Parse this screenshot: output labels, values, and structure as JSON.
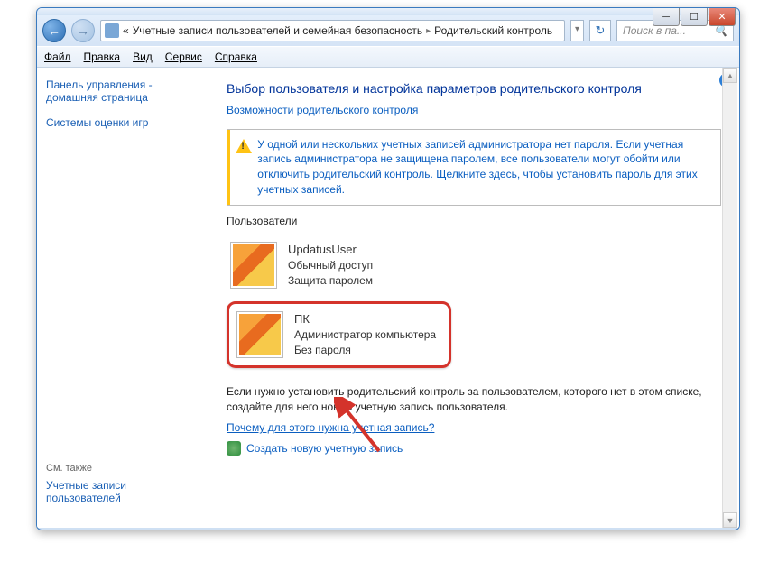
{
  "breadcrumb": {
    "prefix": "«",
    "part1": "Учетные записи пользователей и семейная безопасность",
    "part2": "Родительский контроль"
  },
  "search": {
    "placeholder": "Поиск в па..."
  },
  "menu": {
    "file": "Файл",
    "edit": "Правка",
    "view": "Вид",
    "tools": "Сервис",
    "help": "Справка"
  },
  "sidebar": {
    "cp_home_1": "Панель управления -",
    "cp_home_2": "домашняя страница",
    "game_ratings": "Системы оценки игр",
    "see_also": "См. также",
    "user_accounts": "Учетные записи пользователей"
  },
  "main": {
    "heading": "Выбор пользователя и настройка параметров родительского контроля",
    "cap_link": "Возможности родительского контроля",
    "warning": "У одной или нескольких учетных записей администратора нет пароля. Если учетная запись администратора не защищена паролем, все пользователи могут обойти или отключить родительский контроль. Щелкните здесь, чтобы установить пароль для этих учетных записей.",
    "users_label": "Пользователи",
    "user1": {
      "name": "UpdatusUser",
      "role": "Обычный доступ",
      "pw": "Защита паролем"
    },
    "user2": {
      "name": "ПК",
      "role": "Администратор компьютера",
      "pw": "Без пароля"
    },
    "footer": "Если нужно установить родительский контроль за пользователем, которого нет в этом списке, создайте для него новую учетную запись пользователя.",
    "why_link": "Почему для этого нужна учетная запись?",
    "create_link": "Создать новую учетную запись"
  }
}
